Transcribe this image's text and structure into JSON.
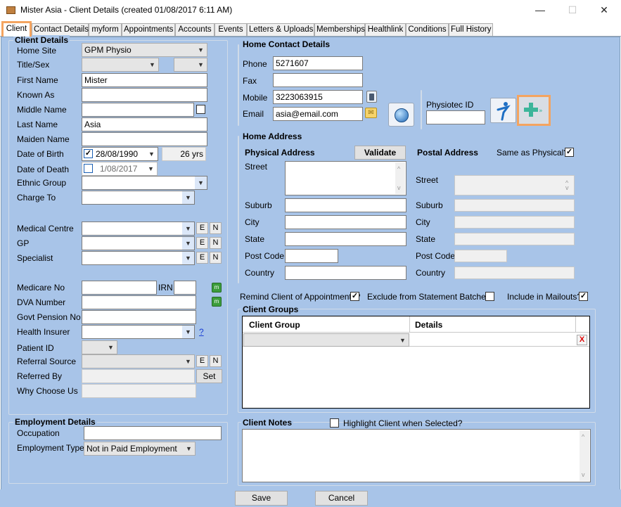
{
  "window": {
    "title": "Mister Asia - Client Details (created 01/08/2017 6:11 AM)",
    "min": "—",
    "max": "☐",
    "close": "✕"
  },
  "tabs": [
    "Client",
    "Contact Details",
    "myform",
    "Appointments",
    "Accounts",
    "Events",
    "Letters & Uploads",
    "Memberships",
    "Healthlink",
    "Conditions",
    "Full History"
  ],
  "client_details": {
    "title": "Client Details",
    "home_site": {
      "label": "Home Site",
      "value": "GPM Physio"
    },
    "title_sex": {
      "label": "Title/Sex",
      "title": "",
      "sex": ""
    },
    "first_name": {
      "label": "First Name",
      "value": "Mister"
    },
    "known_as": {
      "label": "Known As",
      "value": ""
    },
    "middle_name": {
      "label": "Middle Name",
      "value": ""
    },
    "last_name": {
      "label": "Last Name",
      "value": "Asia"
    },
    "maiden_name": {
      "label": "Maiden Name",
      "value": ""
    },
    "dob": {
      "label": "Date of Birth",
      "value": "28/08/1990",
      "age": "26 yrs",
      "checked": "✓"
    },
    "dod": {
      "label": "Date of Death",
      "value": "1/08/2017",
      "checked": ""
    },
    "ethnic": {
      "label": "Ethnic Group",
      "value": ""
    },
    "charge_to": {
      "label": "Charge To",
      "value": ""
    },
    "medical_centre": {
      "label": "Medical Centre",
      "value": ""
    },
    "gp": {
      "label": "GP",
      "value": ""
    },
    "specialist": {
      "label": "Specialist",
      "value": ""
    },
    "e": "E",
    "n": "N",
    "medicare": {
      "label": "Medicare No",
      "value": "",
      "irn_label": "IRN",
      "irn": ""
    },
    "dva": {
      "label": "DVA Number",
      "value": ""
    },
    "pension": {
      "label": "Govt Pension No",
      "value": ""
    },
    "insurer": {
      "label": "Health Insurer",
      "value": "",
      "help": "?"
    },
    "patient_id": {
      "label": "Patient ID",
      "value": ""
    },
    "referral": {
      "label": "Referral Source",
      "value": ""
    },
    "referred_by": {
      "label": "Referred By",
      "value": "",
      "set": "Set"
    },
    "why": {
      "label": "Why Choose Us",
      "value": ""
    }
  },
  "employment": {
    "title": "Employment Details",
    "occupation": {
      "label": "Occupation",
      "value": ""
    },
    "type": {
      "label": "Employment Type",
      "value": "Not in Paid Employment"
    }
  },
  "home_contact": {
    "title": "Home Contact Details",
    "phone": {
      "label": "Phone",
      "value": "5271607"
    },
    "fax": {
      "label": "Fax",
      "value": ""
    },
    "mobile": {
      "label": "Mobile",
      "value": "3223063915"
    },
    "email": {
      "label": "Email",
      "value": "asia@email.com"
    }
  },
  "physiotec": {
    "label": "Physiotec ID",
    "value": ""
  },
  "home_address": {
    "title": "Home Address",
    "physical": "Physical Address",
    "validate": "Validate",
    "postal": "Postal Address",
    "same_as": "Same as Physical?",
    "same_checked": "✓",
    "street": "Street",
    "suburb": "Suburb",
    "city": "City",
    "state": "State",
    "post_code": "Post Code",
    "country": "Country",
    "phys_values": {
      "street": "",
      "suburb": "",
      "city": "",
      "state": "",
      "post_code": "",
      "country": ""
    }
  },
  "options": {
    "remind": "Remind Client of Appointments?",
    "remind_checked": "✓",
    "exclude": "Exclude from Statement Batches?",
    "exclude_checked": "",
    "mailouts": "Include in Mailouts?",
    "mailouts_checked": "✓"
  },
  "client_groups": {
    "title": "Client Groups",
    "col_group": "Client Group",
    "col_details": "Details",
    "delete": "X"
  },
  "notes": {
    "title": "Client Notes",
    "highlight": "Highlight Client when Selected?",
    "value": ""
  },
  "buttons": {
    "save": "Save",
    "cancel": "Cancel"
  }
}
